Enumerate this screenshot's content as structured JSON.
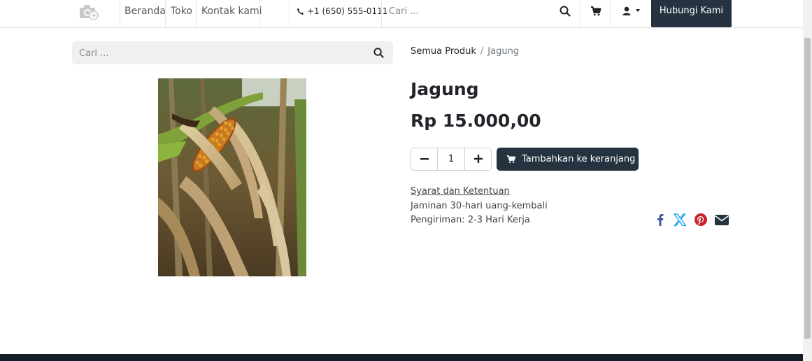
{
  "nav": {
    "links": [
      "Beranda",
      "Toko",
      "Kontak kami"
    ],
    "phone": "+1 (650) 555-0111",
    "search_placeholder": "Cari ...",
    "cta_label": "Hubungi Kami"
  },
  "search": {
    "placeholder": "Cari ..."
  },
  "breadcrumb": {
    "root": "Semua Produk",
    "separator": "/",
    "current": "Jagung"
  },
  "product": {
    "title": "Jagung",
    "price": "Rp 15.000,00",
    "quantity": "1",
    "add_to_cart_label": "Tambahkan ke keranjang",
    "terms_label": "Syarat dan Ketentuan",
    "guarantee": "Jaminan 30-hari uang-kembali",
    "shipping": "Pengiriman: 2-3 Hari Kerja"
  },
  "colors": {
    "dark_button": "#253340",
    "facebook": "#3b5998",
    "x": "#1da1f2",
    "pinterest": "#c8232c",
    "email": "#253340"
  },
  "icons": [
    "logo-camera-icon",
    "phone-icon",
    "search-icon",
    "cart-icon",
    "user-icon",
    "facebook-icon",
    "x-icon",
    "pinterest-icon",
    "email-icon"
  ]
}
